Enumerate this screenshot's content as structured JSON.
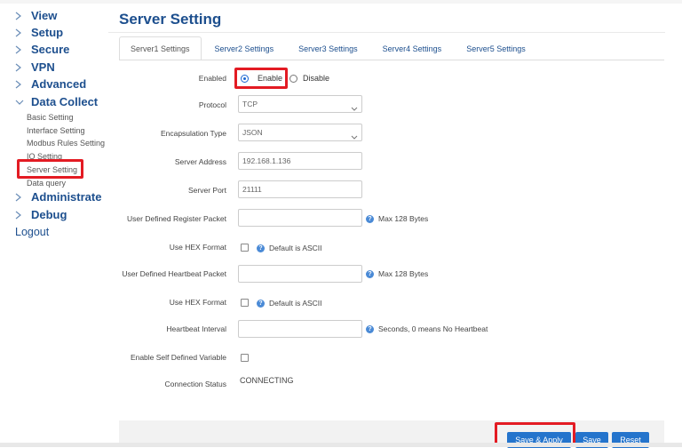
{
  "sidebar": {
    "items": [
      {
        "label": "View"
      },
      {
        "label": "Setup"
      },
      {
        "label": "Secure"
      },
      {
        "label": "VPN"
      },
      {
        "label": "Advanced"
      },
      {
        "label": "Data Collect"
      },
      {
        "label": "Administrate"
      },
      {
        "label": "Debug"
      }
    ],
    "sub_items": [
      {
        "label": "Basic Setting"
      },
      {
        "label": "Interface Setting"
      },
      {
        "label": "Modbus Rules Setting"
      },
      {
        "label": "IO Setting"
      },
      {
        "label": "Server Setting"
      },
      {
        "label": "Data query"
      }
    ],
    "logout": "Logout"
  },
  "main": {
    "title": "Server Setting",
    "tabs": [
      {
        "label": "Server1 Settings"
      },
      {
        "label": "Server2 Settings"
      },
      {
        "label": "Server3 Settings"
      },
      {
        "label": "Server4 Settings"
      },
      {
        "label": "Server5 Settings"
      }
    ],
    "form": {
      "enabled_label": "Enabled",
      "enable_option": "Enable",
      "disable_option": "Disable",
      "protocol_label": "Protocol",
      "protocol_value": "TCP",
      "encapsulation_label": "Encapsulation Type",
      "encapsulation_value": "JSON",
      "server_address_label": "Server Address",
      "server_address_value": "192.168.1.136",
      "server_port_label": "Server Port",
      "server_port_value": "21111",
      "register_packet_label": "User Defined Register Packet",
      "register_packet_value": "",
      "register_help": "Max 128 Bytes",
      "hex_format_label_1": "Use HEX Format",
      "hex_help_1": "Default is ASCII",
      "heartbeat_packet_label": "User Defined Heartbeat Packet",
      "heartbeat_packet_value": "",
      "heartbeat_help": "Max 128 Bytes",
      "hex_format_label_2": "Use HEX Format",
      "hex_help_2": "Default is ASCII",
      "heartbeat_interval_label": "Heartbeat Interval",
      "heartbeat_interval_value": "",
      "heartbeat_interval_help": "Seconds, 0 means No Heartbeat",
      "self_defined_label": "Enable Self Defined Variable",
      "connection_status_label": "Connection Status",
      "connection_status_value": "CONNECTING"
    },
    "buttons": {
      "save_apply": "Save & Apply",
      "save": "Save",
      "reset": "Reset"
    }
  },
  "colors": {
    "accent": "#1d4f8e",
    "button": "#2474cc",
    "highlight": "#e31b23"
  }
}
